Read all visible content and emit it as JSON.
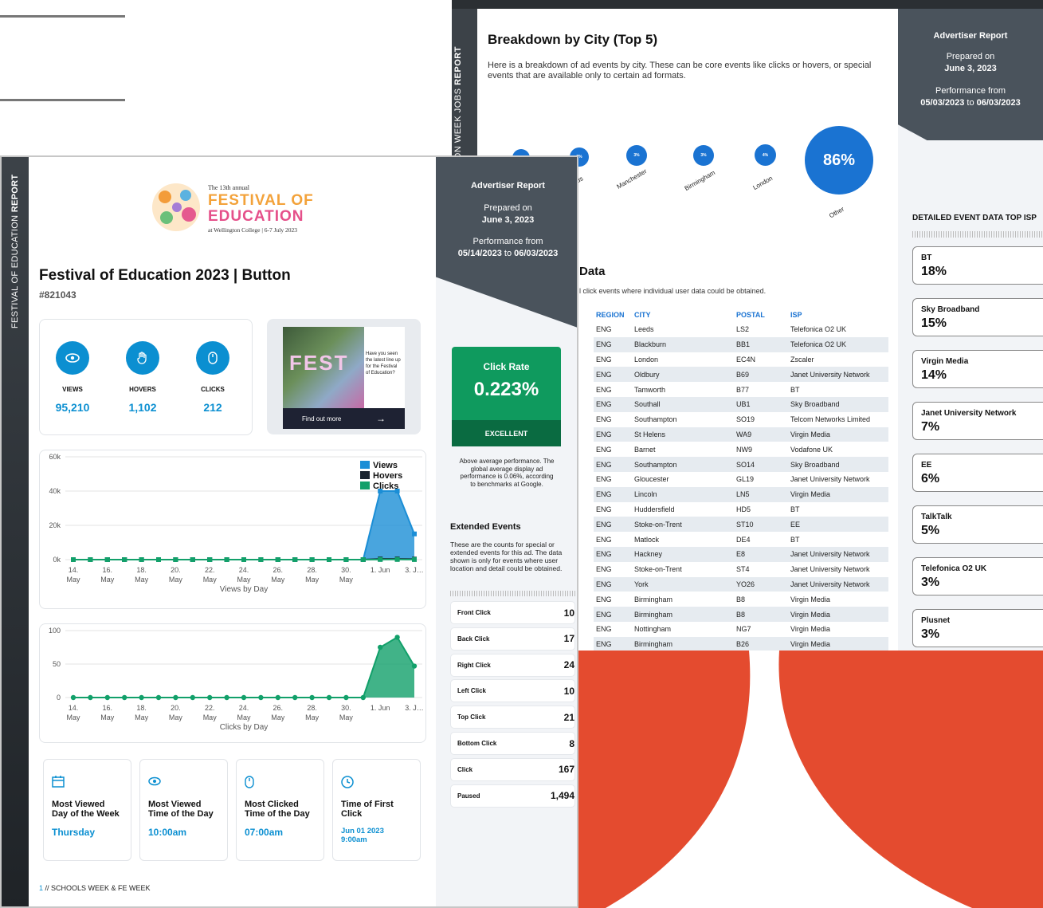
{
  "back_page": {
    "side_label_prefix": "TION WEEK JOBS ",
    "side_label_bold": "REPORT",
    "title": "Breakdown by City (Top 5)",
    "description": "Here is a breakdown of ad events by city. These can be core events like clicks or hovers, or special events that are available only to certain ad formats.",
    "report": {
      "title": "Advertiser Report",
      "prepared_label": "Prepared on",
      "prepared_date": "June 3, 2023",
      "performance_label": "Performance from",
      "range_start": "05/03/2023",
      "range_to": " to ",
      "range_end": "06/03/2023"
    },
    "city_bubbles": [
      {
        "label": "",
        "value": "3%"
      },
      {
        "label": "eds",
        "value": "3%"
      },
      {
        "label": "Manchester",
        "value": "3%"
      },
      {
        "label": "Birmingham",
        "value": "3%"
      },
      {
        "label": "London",
        "value": "4%"
      },
      {
        "label": "Other",
        "value": "86%"
      }
    ],
    "isp_section_title": "DETAILED EVENT DATA TOP ISP",
    "isp_cards": [
      {
        "name": "BT",
        "value": "18%"
      },
      {
        "name": "Sky Broadband",
        "value": "15%"
      },
      {
        "name": "Virgin Media",
        "value": "14%"
      },
      {
        "name": "Janet University Network",
        "value": "7%"
      },
      {
        "name": "EE",
        "value": "6%"
      },
      {
        "name": "TalkTalk",
        "value": "5%"
      },
      {
        "name": "Telefonica O2 UK",
        "value": "3%"
      },
      {
        "name": "Plusnet",
        "value": "3%"
      }
    ],
    "data_title": "Data",
    "data_desc": "l click events where individual user data could be obtained.",
    "table_headers": [
      "REGION",
      "CITY",
      "POSTAL",
      "ISP"
    ],
    "table_rows": [
      [
        "ENG",
        "Leeds",
        "LS2",
        "Telefonica O2 UK"
      ],
      [
        "ENG",
        "Blackburn",
        "BB1",
        "Telefonica O2 UK"
      ],
      [
        "ENG",
        "London",
        "EC4N",
        "Zscaler"
      ],
      [
        "ENG",
        "Oldbury",
        "B69",
        "Janet University Network"
      ],
      [
        "ENG",
        "Tamworth",
        "B77",
        "BT"
      ],
      [
        "ENG",
        "Southall",
        "UB1",
        "Sky Broadband"
      ],
      [
        "ENG",
        "Southampton",
        "SO19",
        "Telcom Networks Limited"
      ],
      [
        "ENG",
        "St Helens",
        "WA9",
        "Virgin Media"
      ],
      [
        "ENG",
        "Barnet",
        "NW9",
        "Vodafone UK"
      ],
      [
        "ENG",
        "Southampton",
        "SO14",
        "Sky Broadband"
      ],
      [
        "ENG",
        "Gloucester",
        "GL19",
        "Janet University Network"
      ],
      [
        "ENG",
        "Lincoln",
        "LN5",
        "Virgin Media"
      ],
      [
        "ENG",
        "Huddersfield",
        "HD5",
        "BT"
      ],
      [
        "ENG",
        "Stoke-on-Trent",
        "ST10",
        "EE"
      ],
      [
        "ENG",
        "Matlock",
        "DE4",
        "BT"
      ],
      [
        "ENG",
        "Hackney",
        "E8",
        "Janet University Network"
      ],
      [
        "ENG",
        "Stoke-on-Trent",
        "ST4",
        "Janet University Network"
      ],
      [
        "ENG",
        "York",
        "YO26",
        "Janet University Network"
      ],
      [
        "ENG",
        "Birmingham",
        "B8",
        "Virgin Media"
      ],
      [
        "ENG",
        "Birmingham",
        "B8",
        "Virgin Media"
      ],
      [
        "ENG",
        "Nottingham",
        "NG7",
        "Virgin Media"
      ],
      [
        "ENG",
        "Birmingham",
        "B26",
        "Virgin Media"
      ]
    ]
  },
  "front_page": {
    "side_label_prefix": "FESTIVAL OF EDUCATION ",
    "side_label_bold": "REPORT",
    "logo": {
      "line1": "The 13th annual",
      "line2": "FESTIVAL OF",
      "line3": "EDUCATION",
      "line4": "at Wellington College | 6-7 July 2023"
    },
    "title": "Festival of Education 2023 | Button",
    "campaign_id": "#821043",
    "stats": [
      {
        "icon": "eye-icon",
        "label": "VIEWS",
        "value": "95,210"
      },
      {
        "icon": "hand-icon",
        "label": "HOVERS",
        "value": "1,102"
      },
      {
        "icon": "mouse-icon",
        "label": "CLICKS",
        "value": "212"
      }
    ],
    "ad_preview": {
      "photo_text": "FEST",
      "side_text": "Have you seen the latest line up for the Festival of Education?",
      "button_label": "Find out more",
      "button_arrow": "→"
    },
    "report": {
      "title": "Advertiser Report",
      "prepared_label": "Prepared on",
      "prepared_date": "June 3, 2023",
      "performance_label": "Performance from",
      "range_start": "05/14/2023",
      "range_to": " to ",
      "range_end": "06/03/2023"
    },
    "click_rate": {
      "title": "Click Rate",
      "value": "0.223%",
      "rating": "EXCELLENT",
      "note": "Above average performance. The global average display ad performance is 0.06%, according to benchmarks at Google."
    },
    "extended": {
      "title": "Extended Events",
      "description": "These are the counts for special or extended events for this ad. The data shown is only for events where user location and detail could be obtained.",
      "rows": [
        {
          "name": "Front Click",
          "value": "10"
        },
        {
          "name": "Back Click",
          "value": "17"
        },
        {
          "name": "Right Click",
          "value": "24"
        },
        {
          "name": "Left Click",
          "value": "10"
        },
        {
          "name": "Top Click",
          "value": "21"
        },
        {
          "name": "Bottom Click",
          "value": "8"
        },
        {
          "name": "Click",
          "value": "167"
        },
        {
          "name": "Paused",
          "value": "1,494"
        }
      ]
    },
    "mini_cards": [
      {
        "icon": "calendar-icon",
        "label": "Most Viewed Day of the Week",
        "value": "Thursday"
      },
      {
        "icon": "eye-icon",
        "label": "Most Viewed Time of the Day",
        "value": "10:00am"
      },
      {
        "icon": "mouse-icon",
        "label": "Most Clicked Time of the Day",
        "value": "07:00am"
      },
      {
        "icon": "clock-icon",
        "label": "Time of First Click",
        "value": "Jun 01 2023 9:00am"
      }
    ],
    "footer_page": "1",
    "footer_text": " // SCHOOLS WEEK & FE WEEK"
  },
  "colors": {
    "views": "#1b8ed6",
    "hovers": "#1a2430",
    "clicks": "#12a06a",
    "accent": "#0b8fd1",
    "red": "#e44b2f"
  },
  "chart_data": [
    {
      "type": "area",
      "title": "",
      "xlabel": "Views by Day",
      "x_ticks": [
        "14. May",
        "16. May",
        "18. May",
        "20. May",
        "22. May",
        "24. May",
        "26. May",
        "28. May",
        "30. May",
        "1. Jun",
        "3. J…"
      ],
      "y_ticks": [
        "0k",
        "20k",
        "40k",
        "60k"
      ],
      "ylim": [
        0,
        60000
      ],
      "legend_position": "top-right",
      "x": [
        "May 14",
        "May 15",
        "May 16",
        "May 17",
        "May 18",
        "May 19",
        "May 20",
        "May 21",
        "May 22",
        "May 23",
        "May 24",
        "May 25",
        "May 26",
        "May 27",
        "May 28",
        "May 29",
        "May 30",
        "May 31",
        "Jun 1",
        "Jun 2",
        "Jun 3"
      ],
      "series": [
        {
          "name": "Views",
          "values": [
            0,
            0,
            0,
            0,
            0,
            0,
            0,
            0,
            0,
            0,
            0,
            0,
            0,
            0,
            0,
            0,
            0,
            0,
            40000,
            40000,
            15000
          ]
        },
        {
          "name": "Hovers",
          "values": [
            0,
            0,
            0,
            0,
            0,
            0,
            0,
            0,
            0,
            0,
            0,
            0,
            0,
            0,
            0,
            0,
            0,
            0,
            400,
            400,
            300
          ]
        },
        {
          "name": "Clicks",
          "values": [
            0,
            0,
            0,
            0,
            0,
            0,
            0,
            0,
            0,
            0,
            0,
            0,
            0,
            0,
            0,
            0,
            0,
            0,
            75,
            90,
            47
          ]
        }
      ]
    },
    {
      "type": "area",
      "title": "",
      "xlabel": "Clicks by Day",
      "x_ticks": [
        "14. May",
        "16. May",
        "18. May",
        "20. May",
        "22. May",
        "24. May",
        "26. May",
        "28. May",
        "30. May",
        "1. Jun",
        "3. J…"
      ],
      "y_ticks": [
        "0",
        "50",
        "100"
      ],
      "ylim": [
        0,
        100
      ],
      "x": [
        "May 14",
        "May 15",
        "May 16",
        "May 17",
        "May 18",
        "May 19",
        "May 20",
        "May 21",
        "May 22",
        "May 23",
        "May 24",
        "May 25",
        "May 26",
        "May 27",
        "May 28",
        "May 29",
        "May 30",
        "May 31",
        "Jun 1",
        "Jun 2",
        "Jun 3"
      ],
      "series": [
        {
          "name": "",
          "values": [
            0,
            0,
            0,
            0,
            0,
            0,
            0,
            0,
            0,
            0,
            0,
            0,
            0,
            0,
            0,
            0,
            0,
            0,
            75,
            90,
            47
          ]
        }
      ]
    }
  ]
}
